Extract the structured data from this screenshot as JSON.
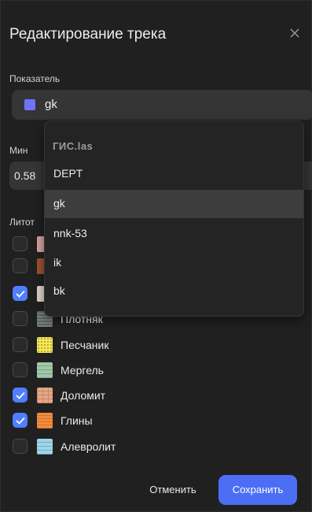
{
  "dialog": {
    "title": "Редактирование трека",
    "metric_label": "Показатель",
    "metric_value": "gk",
    "metric_color": "#6f74ff",
    "min_label": "Мин",
    "min_value": "0.58",
    "litho_label": "Литот",
    "lithologies": [
      {
        "name": "Плотняк",
        "checked": false
      },
      {
        "name": "Песчаник",
        "checked": false
      },
      {
        "name": "Мергель",
        "checked": false
      },
      {
        "name": "Доломит",
        "checked": true
      },
      {
        "name": "Глины",
        "checked": true
      },
      {
        "name": "Алевролит",
        "checked": false
      }
    ],
    "hidden_row_checks": [
      false,
      false,
      true
    ],
    "cancel_label": "Отменить",
    "save_label": "Сохранить",
    "accent_color": "#4c6ef5"
  },
  "dropdown": {
    "group": "ГИС.las",
    "items": [
      "DEPT",
      "gk",
      "nnk-53",
      "ik",
      "bk"
    ],
    "selected": "gk"
  }
}
